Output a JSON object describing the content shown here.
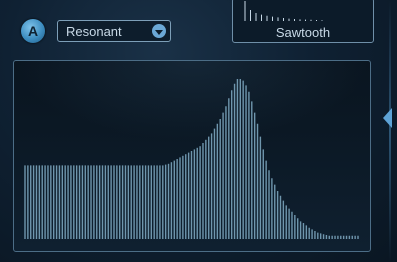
{
  "filter": {
    "badge_letter": "A",
    "type_label": "Resonant"
  },
  "oscillator": {
    "waveform_label": "Sawtooth",
    "harmonic_levels": [
      1.0,
      0.55,
      0.4,
      0.32,
      0.26,
      0.22,
      0.18,
      0.15,
      0.12,
      0.1,
      0.08,
      0.07,
      0.06,
      0.05,
      0.04
    ]
  },
  "spectrum": {
    "bar_color": "#6f96ad",
    "levels": [
      0.46,
      0.46,
      0.46,
      0.46,
      0.46,
      0.46,
      0.46,
      0.46,
      0.46,
      0.46,
      0.46,
      0.46,
      0.46,
      0.46,
      0.46,
      0.46,
      0.46,
      0.46,
      0.46,
      0.46,
      0.46,
      0.46,
      0.46,
      0.46,
      0.46,
      0.46,
      0.46,
      0.46,
      0.46,
      0.46,
      0.46,
      0.46,
      0.46,
      0.46,
      0.46,
      0.46,
      0.46,
      0.46,
      0.46,
      0.46,
      0.46,
      0.46,
      0.46,
      0.46,
      0.46,
      0.46,
      0.46,
      0.46,
      0.46,
      0.465,
      0.47,
      0.48,
      0.49,
      0.5,
      0.51,
      0.52,
      0.53,
      0.54,
      0.55,
      0.56,
      0.57,
      0.58,
      0.6,
      0.62,
      0.64,
      0.66,
      0.69,
      0.72,
      0.75,
      0.79,
      0.83,
      0.88,
      0.93,
      0.97,
      1.0,
      1.0,
      0.99,
      0.96,
      0.92,
      0.86,
      0.79,
      0.72,
      0.64,
      0.56,
      0.49,
      0.43,
      0.38,
      0.34,
      0.3,
      0.27,
      0.24,
      0.21,
      0.19,
      0.17,
      0.15,
      0.13,
      0.11,
      0.1,
      0.085,
      0.07,
      0.06,
      0.05,
      0.04,
      0.035,
      0.03,
      0.025,
      0.02,
      0.02,
      0.02,
      0.02,
      0.02,
      0.02,
      0.02,
      0.02,
      0.02,
      0.02,
      0.02
    ]
  }
}
